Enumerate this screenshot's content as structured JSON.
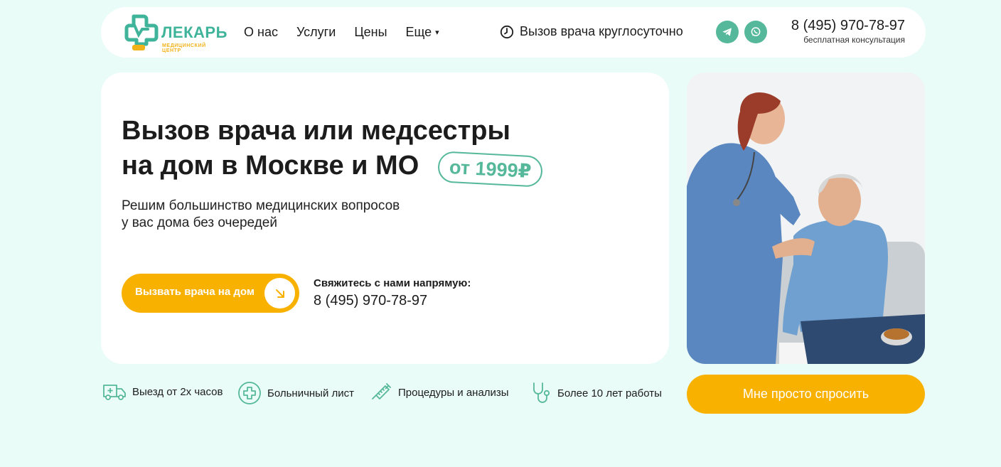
{
  "brand": {
    "name": "ЛЕКАРЬ",
    "tagline": "МЕДИЦИНСКИЙ ЦЕНТР",
    "accent": "#56b89a",
    "secondary": "#f9b100"
  },
  "nav": {
    "items": [
      {
        "label": "О нас"
      },
      {
        "label": "Услуги"
      },
      {
        "label": "Цены"
      },
      {
        "label": "Еще"
      }
    ]
  },
  "header": {
    "call_text": "Вызов врача круглосуточно",
    "phone": "8 (495) 970-78-97",
    "phone_sub": "бесплатная консультация",
    "social": [
      {
        "icon": "telegram-icon"
      },
      {
        "icon": "whatsapp-icon"
      }
    ]
  },
  "hero": {
    "title_line1": "Вызов врача или медсестры",
    "title_line2": "на дом в Москве и МО",
    "price": "от 1999₽",
    "subtitle_line1": "Решим большинство медицинских вопросов",
    "subtitle_line2": "у вас дома без очередей",
    "cta_label": "Вызвать врача на дом",
    "contact_label": "Свяжитесь с нами напрямую:",
    "contact_phone": "8 (495) 970-78-97"
  },
  "ask_button": "Мне просто спросить",
  "features": [
    {
      "icon": "ambulance-icon",
      "label": "Выезд от 2х часов"
    },
    {
      "icon": "medical-cross-icon",
      "label": "Больничный лист"
    },
    {
      "icon": "syringe-icon",
      "label": "Процедуры и анализы"
    },
    {
      "icon": "stethoscope-icon",
      "label": "Более 10 лет работы"
    }
  ]
}
